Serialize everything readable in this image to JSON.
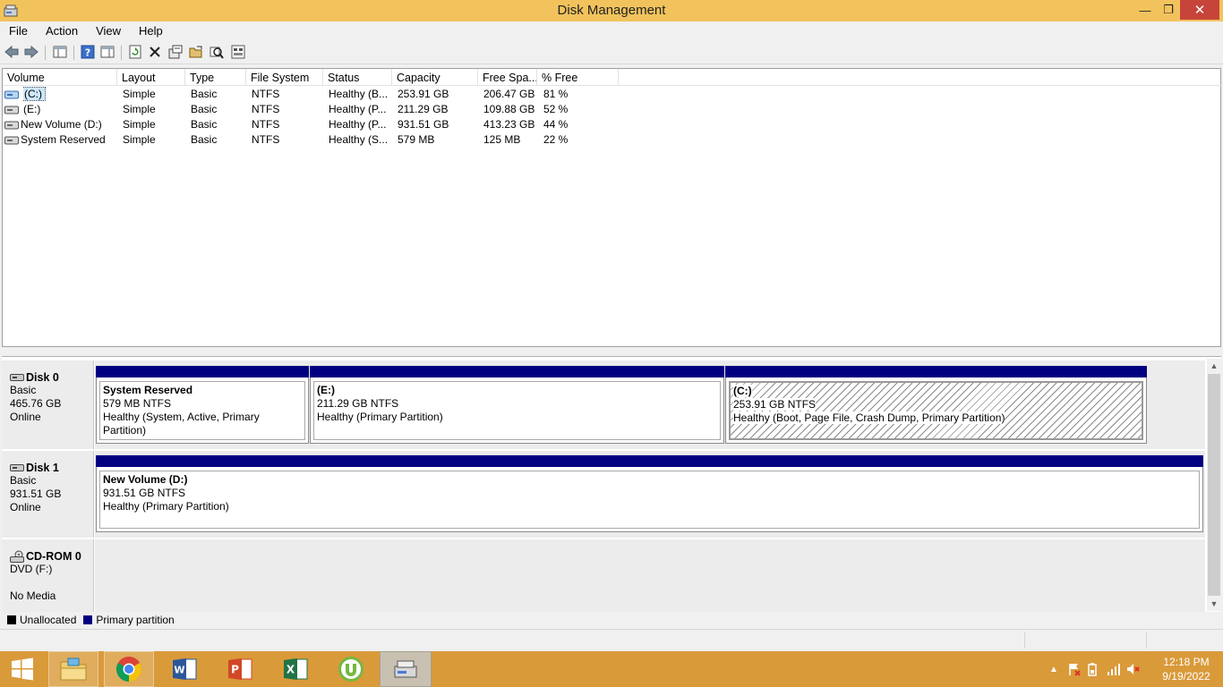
{
  "window": {
    "title": "Disk Management",
    "minimize_glyph": "—",
    "maximize_glyph": "❐",
    "close_glyph": "✕"
  },
  "menu": [
    "File",
    "Action",
    "View",
    "Help"
  ],
  "toolbar_icons": [
    "back-icon",
    "forward-icon",
    "console-tree-icon",
    "help-icon",
    "show-hide-icon",
    "refresh-icon",
    "delete-icon",
    "properties-icon",
    "open-icon",
    "explore-icon",
    "settings-icon"
  ],
  "volume_table": {
    "columns": [
      "Volume",
      "Layout",
      "Type",
      "File System",
      "Status",
      "Capacity",
      "Free Spa...",
      "% Free"
    ],
    "rows": [
      {
        "volume": "(C:)",
        "layout": "Simple",
        "type": "Basic",
        "fs": "NTFS",
        "status": "Healthy (B...",
        "capacity": "253.91 GB",
        "free": "206.47 GB",
        "pct": "81 %"
      },
      {
        "volume": "(E:)",
        "layout": "Simple",
        "type": "Basic",
        "fs": "NTFS",
        "status": "Healthy (P...",
        "capacity": "211.29 GB",
        "free": "109.88 GB",
        "pct": "52 %"
      },
      {
        "volume": "New Volume (D:)",
        "layout": "Simple",
        "type": "Basic",
        "fs": "NTFS",
        "status": "Healthy (P...",
        "capacity": "931.51 GB",
        "free": "413.23 GB",
        "pct": "44 %"
      },
      {
        "volume": "System Reserved",
        "layout": "Simple",
        "type": "Basic",
        "fs": "NTFS",
        "status": "Healthy (S...",
        "capacity": "579 MB",
        "free": "125 MB",
        "pct": "22 %"
      }
    ]
  },
  "disks": [
    {
      "name": "Disk 0",
      "kind": "Basic",
      "size": "465.76 GB",
      "state": "Online",
      "partitions": [
        {
          "name": "System Reserved",
          "size": "579 MB NTFS",
          "status": "Healthy (System, Active, Primary Partition)"
        },
        {
          "name": "(E:)",
          "size": "211.29 GB NTFS",
          "status": "Healthy (Primary Partition)"
        },
        {
          "name": "(C:)",
          "size": "253.91 GB NTFS",
          "status": "Healthy (Boot, Page File, Crash Dump, Primary Partition)"
        }
      ]
    },
    {
      "name": "Disk 1",
      "kind": "Basic",
      "size": "931.51 GB",
      "state": "Online",
      "partitions": [
        {
          "name": "New Volume  (D:)",
          "size": "931.51 GB NTFS",
          "status": "Healthy (Primary Partition)"
        }
      ]
    },
    {
      "name": "CD-ROM 0",
      "kind": "DVD (F:)",
      "state": "No Media"
    }
  ],
  "legend": [
    {
      "label": "Unallocated",
      "color": "#000000"
    },
    {
      "label": "Primary partition",
      "color": "#000080"
    }
  ],
  "taskbar": {
    "apps": [
      "start-icon",
      "file-explorer-icon",
      "chrome-icon",
      "word-icon",
      "powerpoint-icon",
      "excel-icon",
      "utorrent-icon",
      "disk-management-icon"
    ],
    "clock_time": "12:18 PM",
    "clock_date": "9/19/2022",
    "tray_glyph": "▲"
  }
}
